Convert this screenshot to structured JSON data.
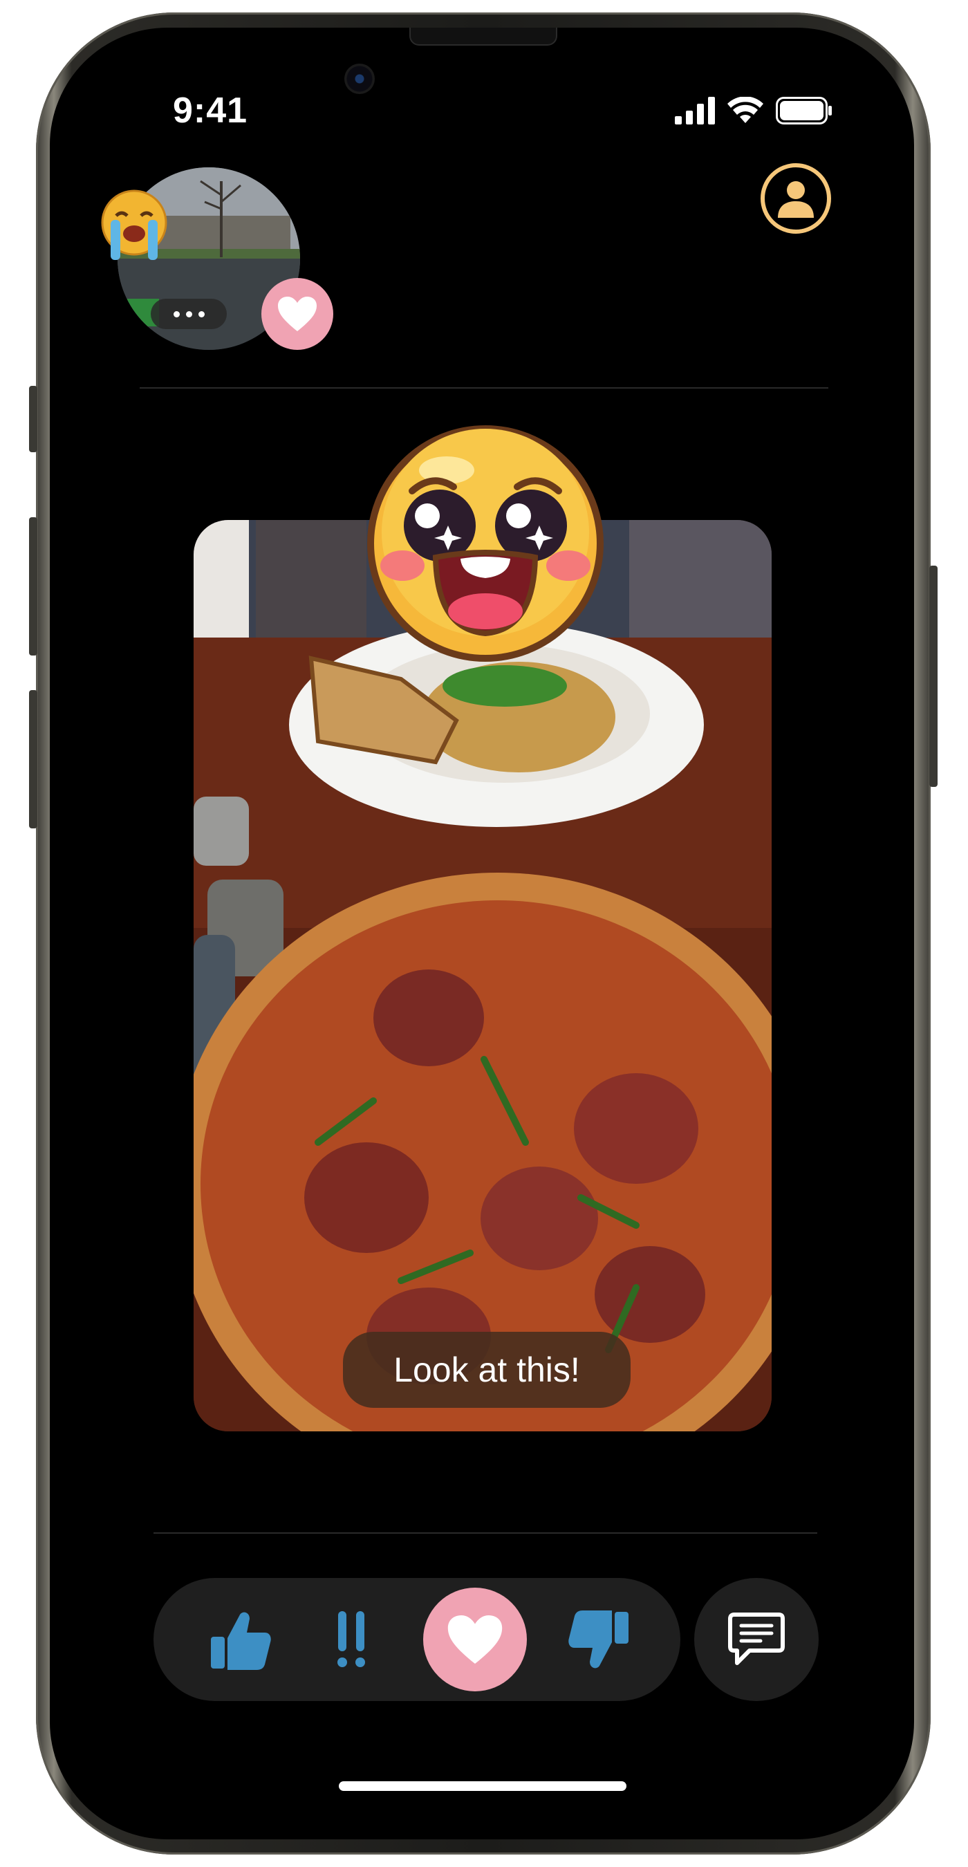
{
  "status_bar": {
    "time": "9:41"
  },
  "icons": {
    "signal": "cellular-signal-icon",
    "wifi": "wifi-icon",
    "battery": "battery-icon",
    "profile": "profile-icon",
    "heart": "heart-icon",
    "thumbs_up": "thumbs-up-icon",
    "exclaim": "double-exclamation-icon",
    "thumbs_down": "thumbs-down-icon",
    "chat": "chat-bubble-icon",
    "crying": "crying-emoji-icon",
    "starstruck": "starstruck-emoji-icon"
  },
  "post": {
    "caption": "Look at this!"
  },
  "colors": {
    "accent_heart": "#f0a3b3",
    "accent_profile": "#f6c77a",
    "reaction_blue": "#3d8fc4",
    "bar_bg": "#1f1f1f"
  }
}
